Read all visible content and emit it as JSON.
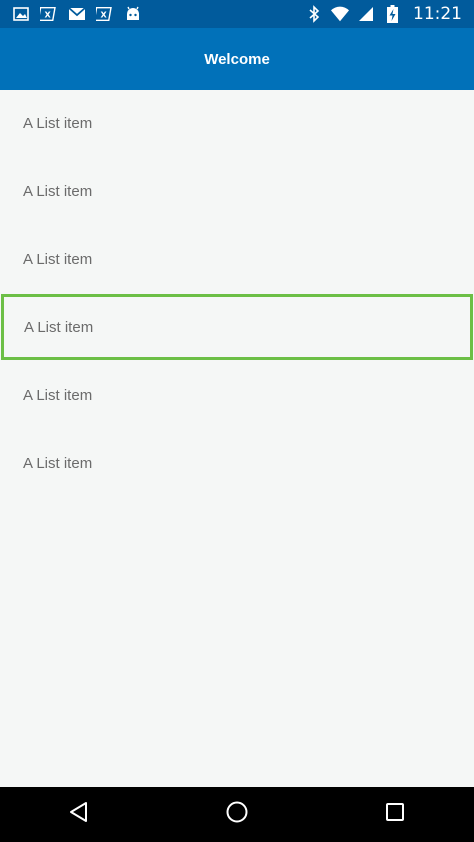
{
  "status_bar": {
    "time": "11:21",
    "left_icons": [
      "image-icon",
      "xamarin-icon",
      "gmail-icon",
      "xamarin-icon",
      "android-icon"
    ],
    "right_icons": [
      "bluetooth-icon",
      "wifi-icon",
      "cell-signal-icon",
      "battery-charging-icon"
    ]
  },
  "app_bar": {
    "title": "Welcome",
    "color": "#0171b9"
  },
  "list": {
    "items": [
      {
        "label": "A List item"
      },
      {
        "label": "A List item"
      },
      {
        "label": "A List item"
      },
      {
        "label": "A List item",
        "selected": true
      },
      {
        "label": "A List item"
      },
      {
        "label": "A List item"
      }
    ],
    "highlight_color": "#6cbf46"
  },
  "nav_bar": {
    "buttons": [
      "back-icon",
      "home-icon",
      "recents-icon"
    ]
  }
}
